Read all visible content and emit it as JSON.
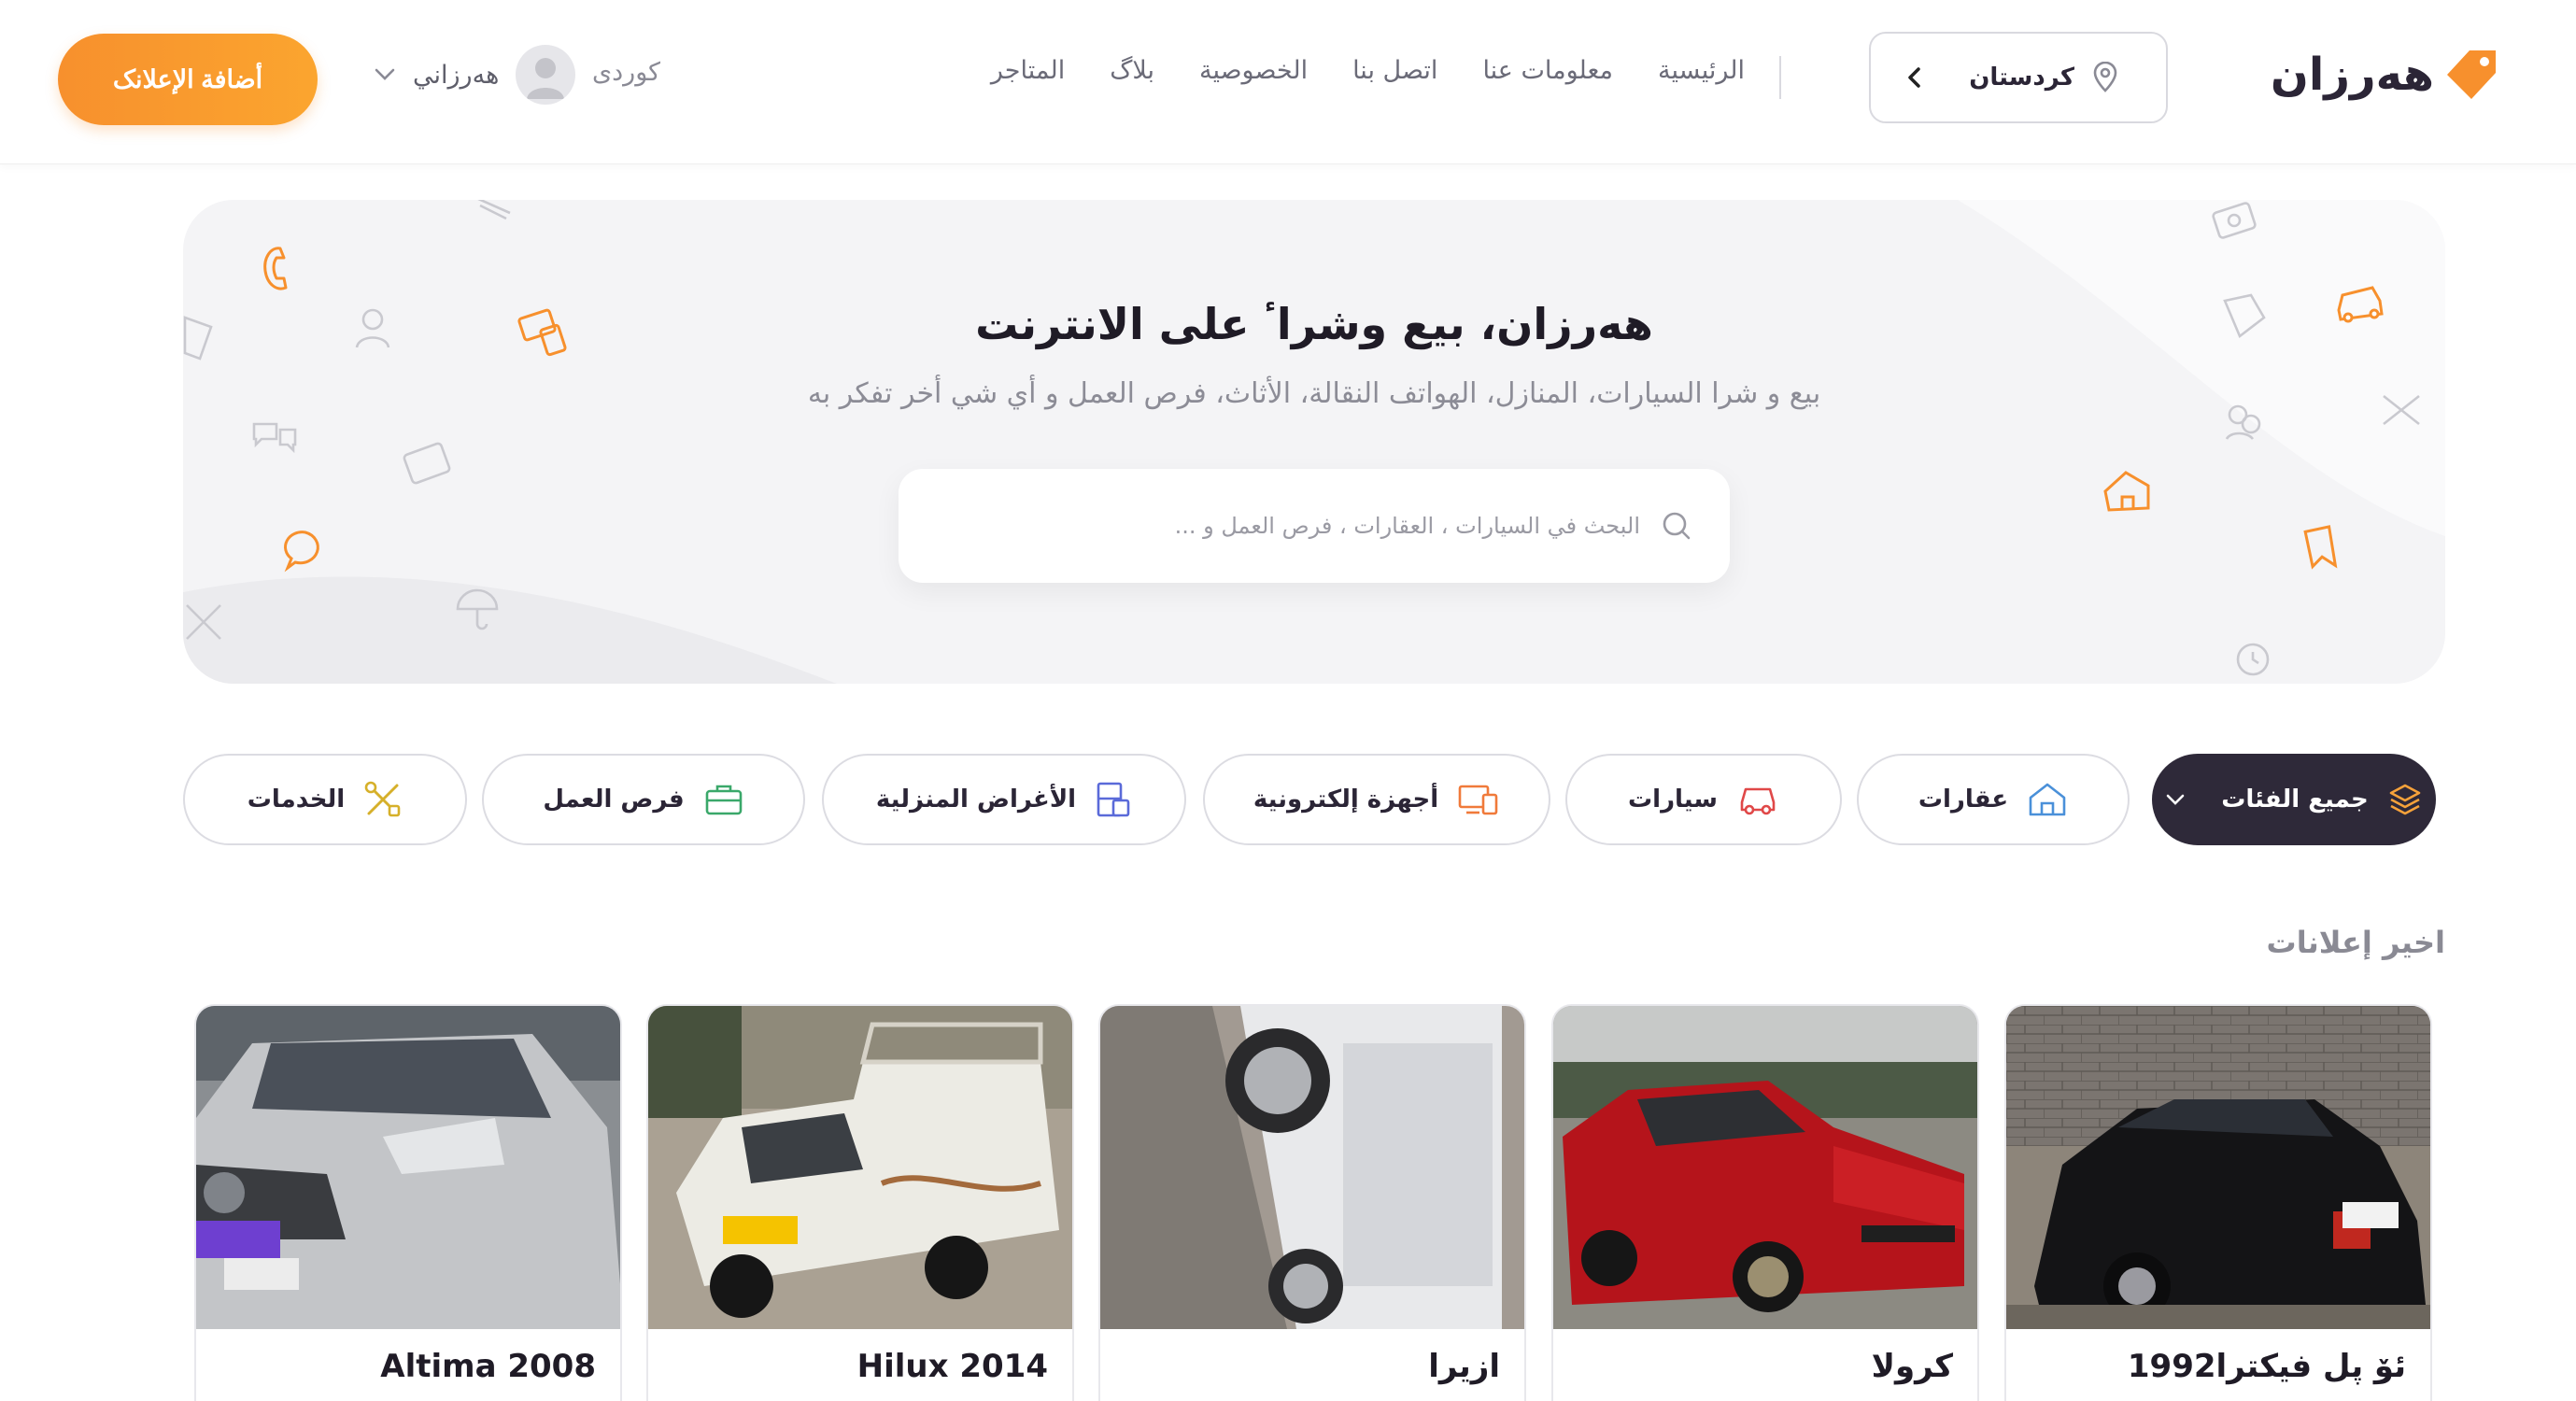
{
  "header": {
    "logo_text": "هەرزان",
    "region": "كردستان",
    "nav": [
      "الرئيسية",
      "معلومات عنا",
      "اتصل بنا",
      "الخصوصية",
      "بلاگ",
      "المتاجر"
    ],
    "user_name": "هەرزاني",
    "language": "كوردى",
    "add_button": "أضافة الإعلانک"
  },
  "hero": {
    "title": "هەرزان، بيع وشراٴ على الانترنت",
    "subtitle": "بيع و شرا‌ السيارات، المنازل، الهواتف النقالة، الأثاث، فرص العمل و أي شي أخر تفكر به",
    "search_placeholder": "البحث في السيارات ، العقارات ، فرص العمل و ..."
  },
  "categories": [
    {
      "label": "جميع الفئات",
      "icon": "layers-icon",
      "active": true
    },
    {
      "label": "عقارات",
      "icon": "house-icon"
    },
    {
      "label": "سيارات",
      "icon": "car-icon"
    },
    {
      "label": "أجهزة إلكترونية",
      "icon": "devices-icon"
    },
    {
      "label": "الأغراض المنزلية",
      "icon": "furniture-icon"
    },
    {
      "label": "فرص العمل",
      "icon": "briefcase-icon"
    },
    {
      "label": "الخدمات",
      "icon": "tools-icon"
    }
  ],
  "latest": {
    "title": "اخير إعلانات",
    "ads": [
      "ئۆ پل فيكترا1992",
      "كرولا",
      "ازيرا",
      "Hilux 2014",
      "Altima 2008"
    ]
  },
  "colors": {
    "accent": "#f7902d",
    "dark": "#2e2939",
    "muted": "#8a8a94"
  }
}
